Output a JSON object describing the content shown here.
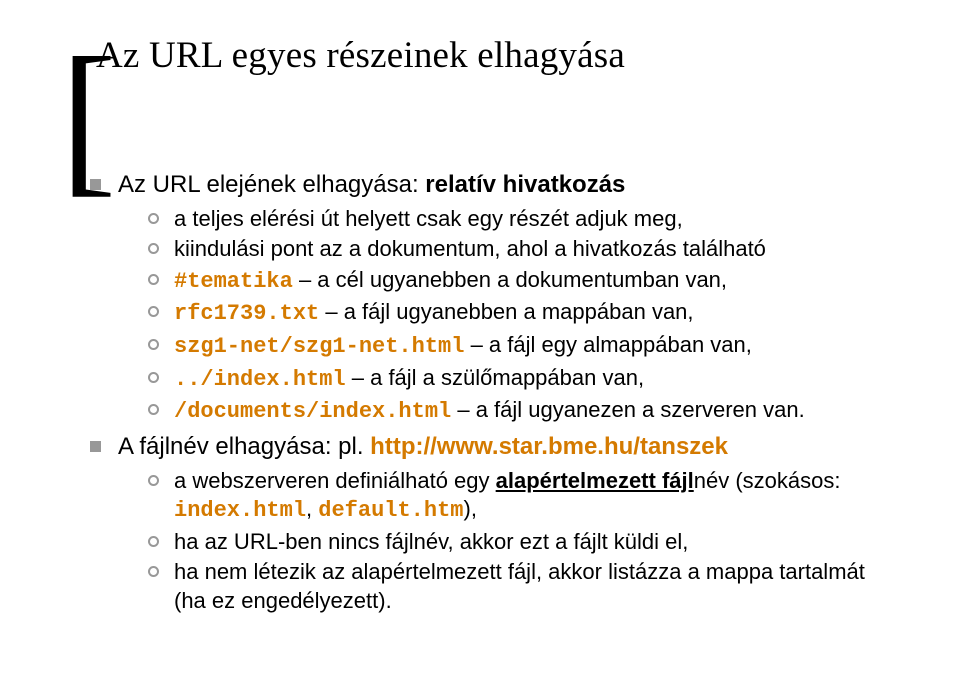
{
  "title": "Az URL egyes részeinek elhagyása",
  "b1": {
    "intro": "Az URL elejének elhagyása: ",
    "intro_bold": "relatív hivatkozás",
    "s1": "a teljes elérési út helyett csak egy részét adjuk meg,",
    "s2": "kiindulási pont az a dokumentum, ahol a hivatkozás található",
    "s3a": "#tematika",
    "s3b": " – a cél ugyanebben a dokumentumban van,",
    "s4a": "rfc1739.txt",
    "s4b": " – a fájl ugyanebben a mappában van,",
    "s5a": "szg1-net/szg1-net.html",
    "s5b": " – a fájl egy almappában van,",
    "s6a": "../index.html",
    "s6b": " – a fájl a szülőmappában van,",
    "s7a": "/documents/index.html",
    "s7b": " – a fájl ugyanezen a szerveren van."
  },
  "b2": {
    "intro": "A fájlnév elhagyása: pl. ",
    "intro_link": "http://www.star.bme.hu/tanszek",
    "s1a": "a webszerveren definiálható egy ",
    "s1b": "alapértelmezett fájl",
    "s1c": "név (szokásos: ",
    "s1d": "index.html",
    "s1e": ", ",
    "s1f": "default.htm",
    "s1g": "),",
    "s2": "ha az URL-ben nincs fájlnév, akkor ezt a fájlt küldi el,",
    "s3": "ha nem létezik az alapértelmezett fájl, akkor listázza a mappa tartalmát (ha ez engedélyezett)."
  }
}
